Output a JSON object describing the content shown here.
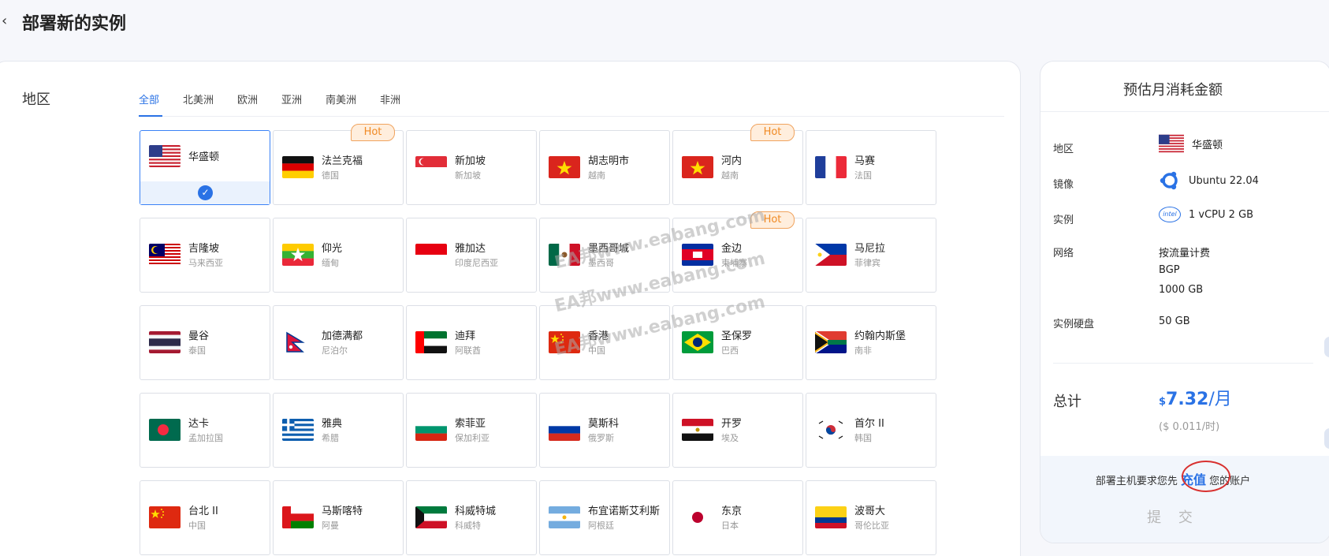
{
  "header": {
    "back_icon": "‹",
    "title": "部署新的实例"
  },
  "region": {
    "label": "地区",
    "tabs": [
      "全部",
      "北美洲",
      "欧洲",
      "亚洲",
      "南美洲",
      "非洲"
    ],
    "hot_label": "Hot",
    "locations": [
      {
        "name": "华盛顿",
        "country": "",
        "flag": "us",
        "selected": true
      },
      {
        "name": "法兰克福",
        "country": "德国",
        "flag": "de",
        "hot": true
      },
      {
        "name": "新加坡",
        "country": "新加坡",
        "flag": "sg"
      },
      {
        "name": "胡志明市",
        "country": "越南",
        "flag": "vn"
      },
      {
        "name": "河内",
        "country": "越南",
        "flag": "vn",
        "hot": true
      },
      {
        "name": "马赛",
        "country": "法国",
        "flag": "fr"
      },
      {
        "name": "吉隆坡",
        "country": "马来西亚",
        "flag": "my"
      },
      {
        "name": "仰光",
        "country": "缅甸",
        "flag": "mm"
      },
      {
        "name": "雅加达",
        "country": "印度尼西亚",
        "flag": "id"
      },
      {
        "name": "墨西哥城",
        "country": "墨西哥",
        "flag": "mx"
      },
      {
        "name": "金边",
        "country": "柬埔寨",
        "flag": "kh",
        "hot": true
      },
      {
        "name": "马尼拉",
        "country": "菲律宾",
        "flag": "ph"
      },
      {
        "name": "曼谷",
        "country": "泰国",
        "flag": "th"
      },
      {
        "name": "加德满都",
        "country": "尼泊尔",
        "flag": "np"
      },
      {
        "name": "迪拜",
        "country": "阿联酋",
        "flag": "ae"
      },
      {
        "name": "香港",
        "country": "中国",
        "flag": "cn"
      },
      {
        "name": "圣保罗",
        "country": "巴西",
        "flag": "br"
      },
      {
        "name": "约翰内斯堡",
        "country": "南非",
        "flag": "za"
      },
      {
        "name": "达卡",
        "country": "孟加拉国",
        "flag": "bd"
      },
      {
        "name": "雅典",
        "country": "希腊",
        "flag": "gr"
      },
      {
        "name": "索菲亚",
        "country": "保加利亚",
        "flag": "bg"
      },
      {
        "name": "莫斯科",
        "country": "俄罗斯",
        "flag": "ru"
      },
      {
        "name": "开罗",
        "country": "埃及",
        "flag": "eg"
      },
      {
        "name": "首尔 II",
        "country": "韩国",
        "flag": "kr"
      },
      {
        "name": "台北 II",
        "country": "中国",
        "flag": "cn"
      },
      {
        "name": "马斯喀特",
        "country": "阿曼",
        "flag": "om"
      },
      {
        "name": "科威特城",
        "country": "科威特",
        "flag": "kw"
      },
      {
        "name": "布宜诺斯艾利斯",
        "country": "阿根廷",
        "flag": "ar"
      },
      {
        "name": "东京",
        "country": "日本",
        "flag": "jp"
      },
      {
        "name": "波哥大",
        "country": "哥伦比亚",
        "flag": "co"
      }
    ]
  },
  "watermark": "EA邦www.eabang.com",
  "summary": {
    "title": "预估月消耗金额",
    "rows": {
      "region_label": "地区",
      "region_value": "华盛顿",
      "image_label": "镜像",
      "image_value": "Ubuntu 22.04",
      "instance_label": "实例",
      "instance_value": "1 vCPU 2 GB",
      "network_label": "网络",
      "network_values": [
        "按流量计费",
        "BGP",
        "1000 GB"
      ],
      "disk_label": "实例硬盘",
      "disk_value": "50 GB"
    },
    "total_label": "总计",
    "currency": "$",
    "amount": "7.32",
    "per_month": "/月",
    "hourly": "($ 0.011/时)",
    "notice_before": "部署主机要求您先",
    "notice_link": "充值",
    "notice_after": "您的账户",
    "submit_label": "提 交",
    "intel_logo_text": "intel",
    "icons": {
      "ubuntu": "ubuntu-logo-icon",
      "intel": "intel-logo-icon"
    },
    "accent_color": "#2a72e5"
  }
}
